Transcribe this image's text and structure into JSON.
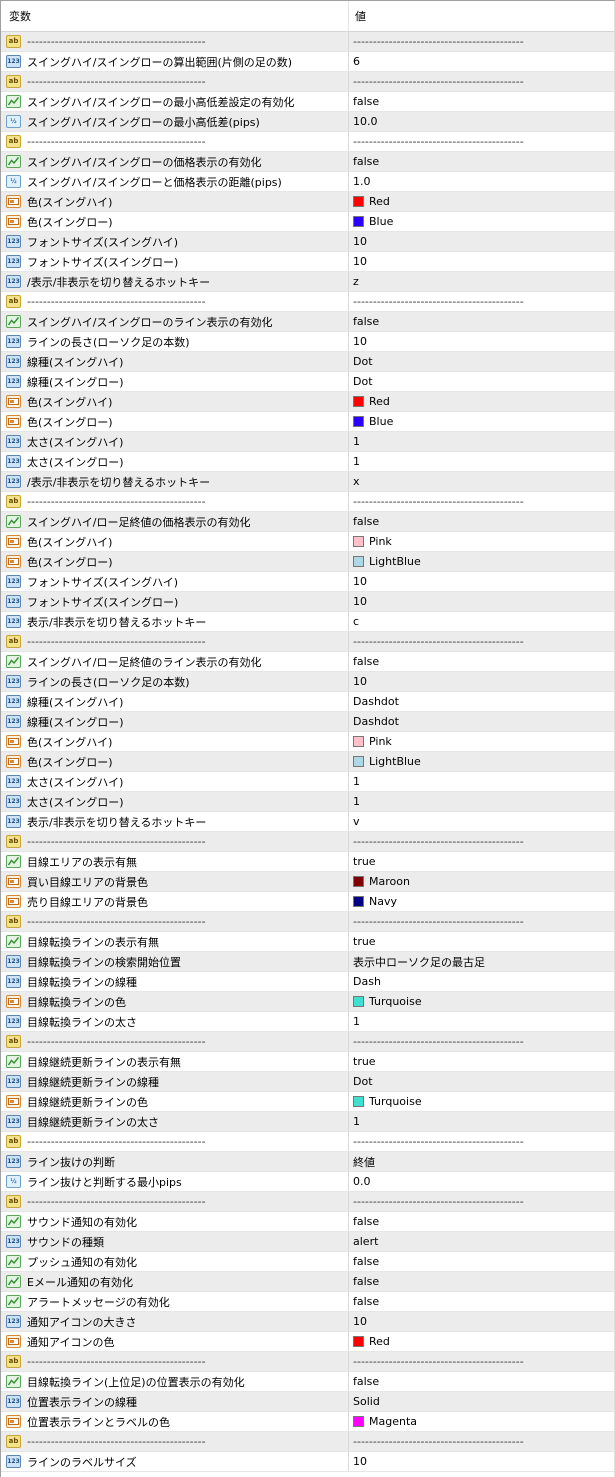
{
  "header": {
    "col_variable": "変数",
    "col_value": "値"
  },
  "rows": [
    {
      "type": "string",
      "name": "---------------------------------------------",
      "value": "-------------------------------------------"
    },
    {
      "type": "int",
      "name": "スイングハイ/スイングローの算出範囲(片側の足の数)",
      "value": "6"
    },
    {
      "type": "string",
      "name": "---------------------------------------------",
      "value": "-------------------------------------------"
    },
    {
      "type": "bool",
      "name": "スイングハイ/スイングローの最小高低差設定の有効化",
      "value": "false"
    },
    {
      "type": "double",
      "name": "スイングハイ/スイングローの最小高低差(pips)",
      "value": "10.0"
    },
    {
      "type": "string",
      "name": "---------------------------------------------",
      "value": "-------------------------------------------"
    },
    {
      "type": "bool",
      "name": "スイングハイ/スイングローの価格表示の有効化",
      "value": "false"
    },
    {
      "type": "double",
      "name": "スイングハイ/スイングローと価格表示の距離(pips)",
      "value": "1.0"
    },
    {
      "type": "color",
      "name": "色(スイングハイ)",
      "value": "Red",
      "swatch": "#ff0000"
    },
    {
      "type": "color",
      "name": "色(スイングロー)",
      "value": "Blue",
      "swatch": "#2a00ff"
    },
    {
      "type": "int",
      "name": "フォントサイズ(スイングハイ)",
      "value": "10"
    },
    {
      "type": "int",
      "name": "フォントサイズ(スイングロー)",
      "value": "10"
    },
    {
      "type": "int",
      "name": "/表示/非表示を切り替えるホットキー",
      "value": "z"
    },
    {
      "type": "string",
      "name": "---------------------------------------------",
      "value": "-------------------------------------------"
    },
    {
      "type": "bool",
      "name": "スイングハイ/スイングローのライン表示の有効化",
      "value": "false"
    },
    {
      "type": "int",
      "name": "ラインの長さ(ローソク足の本数)",
      "value": "10"
    },
    {
      "type": "int",
      "name": "線種(スイングハイ)",
      "value": "Dot"
    },
    {
      "type": "int",
      "name": "線種(スイングロー)",
      "value": "Dot"
    },
    {
      "type": "color",
      "name": "色(スイングハイ)",
      "value": "Red",
      "swatch": "#ff0000"
    },
    {
      "type": "color",
      "name": "色(スイングロー)",
      "value": "Blue",
      "swatch": "#2a00ff"
    },
    {
      "type": "int",
      "name": "太さ(スイングハイ)",
      "value": "1"
    },
    {
      "type": "int",
      "name": "太さ(スイングロー)",
      "value": "1"
    },
    {
      "type": "int",
      "name": "/表示/非表示を切り替えるホットキー",
      "value": "x"
    },
    {
      "type": "string",
      "name": "---------------------------------------------",
      "value": "-------------------------------------------"
    },
    {
      "type": "bool",
      "name": "スイングハイ/ロー足終値の価格表示の有効化",
      "value": "false"
    },
    {
      "type": "color",
      "name": "色(スイングハイ)",
      "value": "Pink",
      "swatch": "#ffc0cb"
    },
    {
      "type": "color",
      "name": "色(スイングロー)",
      "value": "LightBlue",
      "swatch": "#add8e6"
    },
    {
      "type": "int",
      "name": "フォントサイズ(スイングハイ)",
      "value": "10"
    },
    {
      "type": "int",
      "name": "フォントサイズ(スイングロー)",
      "value": "10"
    },
    {
      "type": "int",
      "name": "表示/非表示を切り替えるホットキー",
      "value": "c"
    },
    {
      "type": "string",
      "name": "---------------------------------------------",
      "value": "-------------------------------------------"
    },
    {
      "type": "bool",
      "name": "スイングハイ/ロー足終値のライン表示の有効化",
      "value": "false"
    },
    {
      "type": "int",
      "name": "ラインの長さ(ローソク足の本数)",
      "value": "10"
    },
    {
      "type": "int",
      "name": "線種(スイングハイ)",
      "value": "Dashdot"
    },
    {
      "type": "int",
      "name": "線種(スイングロー)",
      "value": "Dashdot"
    },
    {
      "type": "color",
      "name": "色(スイングハイ)",
      "value": "Pink",
      "swatch": "#ffc0cb"
    },
    {
      "type": "color",
      "name": "色(スイングロー)",
      "value": "LightBlue",
      "swatch": "#add8e6"
    },
    {
      "type": "int",
      "name": "太さ(スイングハイ)",
      "value": "1"
    },
    {
      "type": "int",
      "name": "太さ(スイングロー)",
      "value": "1"
    },
    {
      "type": "int",
      "name": "表示/非表示を切り替えるホットキー",
      "value": "v"
    },
    {
      "type": "string",
      "name": "---------------------------------------------",
      "value": "-------------------------------------------"
    },
    {
      "type": "bool",
      "name": "目線エリアの表示有無",
      "value": "true"
    },
    {
      "type": "color",
      "name": "買い目線エリアの背景色",
      "value": "Maroon",
      "swatch": "#800000"
    },
    {
      "type": "color",
      "name": "売り目線エリアの背景色",
      "value": "Navy",
      "swatch": "#000080"
    },
    {
      "type": "string",
      "name": "---------------------------------------------",
      "value": "-------------------------------------------"
    },
    {
      "type": "bool",
      "name": "目線転換ラインの表示有無",
      "value": "true"
    },
    {
      "type": "int",
      "name": "目線転換ラインの検索開始位置",
      "value": "表示中ローソク足の最古足"
    },
    {
      "type": "int",
      "name": "目線転換ラインの線種",
      "value": "Dash"
    },
    {
      "type": "color",
      "name": "目線転換ラインの色",
      "value": "Turquoise",
      "swatch": "#40e0d0"
    },
    {
      "type": "int",
      "name": "目線転換ラインの太さ",
      "value": "1"
    },
    {
      "type": "string",
      "name": "---------------------------------------------",
      "value": "-------------------------------------------"
    },
    {
      "type": "bool",
      "name": "目線継続更新ラインの表示有無",
      "value": "true"
    },
    {
      "type": "int",
      "name": "目線継続更新ラインの線種",
      "value": "Dot"
    },
    {
      "type": "color",
      "name": "目線継続更新ラインの色",
      "value": "Turquoise",
      "swatch": "#40e0d0"
    },
    {
      "type": "int",
      "name": "目線継続更新ラインの太さ",
      "value": "1"
    },
    {
      "type": "string",
      "name": "---------------------------------------------",
      "value": "-------------------------------------------"
    },
    {
      "type": "int",
      "name": "ライン抜けの判断",
      "value": "終値"
    },
    {
      "type": "double",
      "name": "ライン抜けと判断する最小pips",
      "value": "0.0"
    },
    {
      "type": "string",
      "name": "---------------------------------------------",
      "value": "-------------------------------------------"
    },
    {
      "type": "bool",
      "name": "サウンド通知の有効化",
      "value": "false"
    },
    {
      "type": "int",
      "name": "サウンドの種類",
      "value": "alert"
    },
    {
      "type": "bool",
      "name": "プッシュ通知の有効化",
      "value": "false"
    },
    {
      "type": "bool",
      "name": "Eメール通知の有効化",
      "value": "false"
    },
    {
      "type": "bool",
      "name": "アラートメッセージの有効化",
      "value": "false"
    },
    {
      "type": "int",
      "name": "通知アイコンの大きさ",
      "value": "10"
    },
    {
      "type": "color",
      "name": "通知アイコンの色",
      "value": "Red",
      "swatch": "#ff0000"
    },
    {
      "type": "string",
      "name": "---------------------------------------------",
      "value": "-------------------------------------------"
    },
    {
      "type": "bool",
      "name": "目線転換ライン(上位足)の位置表示の有効化",
      "value": "false"
    },
    {
      "type": "int",
      "name": "位置表示ラインの線種",
      "value": "Solid"
    },
    {
      "type": "color",
      "name": "位置表示ラインとラベルの色",
      "value": "Magenta",
      "swatch": "#ff00ff"
    },
    {
      "type": "string",
      "name": "---------------------------------------------",
      "value": "-------------------------------------------"
    },
    {
      "type": "int",
      "name": "ラインのラベルサイズ",
      "value": "10"
    }
  ],
  "icons": {
    "string": {
      "label": "ab",
      "name": "string-type-icon"
    },
    "int": {
      "label": "123",
      "name": "integer-type-icon"
    },
    "double": {
      "label": "½",
      "name": "double-type-icon"
    },
    "bool": {
      "label": "",
      "name": "boolean-type-icon"
    },
    "color": {
      "label": "",
      "name": "color-type-icon"
    }
  }
}
